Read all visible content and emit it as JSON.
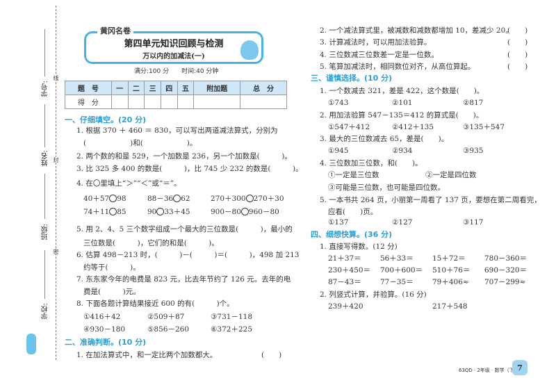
{
  "binding": {
    "student_id": "学号:",
    "name": "姓名:",
    "class": "班级:",
    "school": "学校:",
    "cut_marks": [
      "线",
      "封",
      "密"
    ]
  },
  "header": {
    "brand": "黄冈名卷",
    "title": "第四单元知识回顾与检测",
    "subtitle": "万以内的加减法(一)",
    "meta": "满分:100 分　　时间:40 分钟"
  },
  "score_table": {
    "headers": [
      "题　号",
      "一",
      "二",
      "三",
      "四",
      "五",
      "附加题",
      "总　分"
    ],
    "row_label": "得　分"
  },
  "s1": {
    "title": "一、仔细填空。(20 分)",
    "q1a": "1. 根据 370 ＋ 460 ＝ 830，可以写出两道减法算式，分别为",
    "q1b": "(　　　　　　)和(　　　　　　)。",
    "q2": "2. 两个数的和是 529，一个加数是 236，另一个加数是(　　　)。",
    "q3": "3. 比 325 多 400 的数是(　　　)，比 745 少 232 的数是(　　　)。",
    "q4": "4. 在〇里填上“＞”“＜”或“＝”。",
    "compare": [
      [
        "40＋57",
        "98"
      ],
      [
        "88－36",
        "62"
      ],
      [
        "270＋300",
        "270＋30"
      ],
      [
        "74＋11",
        "85"
      ],
      [
        "90",
        "33＋45"
      ],
      [
        "900－80",
        "960－80"
      ]
    ],
    "q5a": "5. 用 2、4、5 三个数字组成一个最大的三位数是(　　　)，最小的",
    "q5b": "三位数是(　　　)，它们的和是(　　　)。",
    "q6a": "6. 估算 498－213 时，(　　　)－(　　　)＝(　　　)，498 加 213",
    "q6b": "约等于(　　　)。",
    "q7a": "7. 东东家今年的电费是 823 元，比去年节约了 126 元。去年的电",
    "q7b": "费是(　　　)元。",
    "q8": "8. 下面各题计算结果接近 600 的有(　　　)个。",
    "q8opts": [
      "①416＋42",
      "②509＋87",
      "③731－118",
      "④930－180",
      "⑤856－260",
      "⑥372＋225"
    ]
  },
  "s2": {
    "title": "二、准确判断。(10 分)",
    "items": [
      "1. 在加法算式中，和一定比两个加数都大。",
      "2. 一个减法算式里，被减数和减数都增加 10，差减少 20。",
      "3. 计算减法时，可以用加法验算。",
      "4. 三位数减三位数差一定是一位数。",
      "5. 笔算加减法时，相同数位对齐，从高位算起。"
    ],
    "paren": "(　　)"
  },
  "s3": {
    "title": "三、谨慎选择。(10 分)",
    "q1": "1. 一个数减去 321，差是 422，这个数是(　　)。",
    "q1o": [
      "①743",
      "②101",
      "②817"
    ],
    "q2": "2. 用加法验算 547－135＝412 的算式是(　　)。",
    "q2o": [
      "①547＋412",
      "②412＋135",
      "③135＋547"
    ],
    "q3": "3. 最大的三位数减去 65，差是(　　)。",
    "q3o": [
      "①945",
      "②934",
      "③935"
    ],
    "q4": "4. 三位数加三位数，和(　　)。",
    "q4o": [
      "①一定是三位数",
      "②一定是四位数",
      "③可能是三位数，也可能是四位数。"
    ],
    "q5a": "5. 一本书共 264 页，小丽第一周看了 137 页，要想在第二周看完，",
    "q5b": "应看(　　)页。",
    "q5o": [
      "①137",
      "②127",
      "③117"
    ]
  },
  "s4": {
    "title": "四、细想快算。(36 分)",
    "q1": "1. 直接写得数。(12 分)",
    "calc": [
      "21＋37＝",
      "56＋33＝",
      "15＋72＝",
      "780－360＝",
      "230＋450＝",
      "700＋600＝",
      "510＋76＝",
      "690－320＝",
      "87－43＝",
      "77－35＝",
      "79＋406≈",
      "707－299≈"
    ],
    "q2": "2. 列竖式计算，并验算。(16 分)",
    "vert": [
      "239＋420",
      "217＋548"
    ]
  },
  "footer": {
    "text": "63QD · 2年级 · 数学（下）",
    "page": "7"
  }
}
